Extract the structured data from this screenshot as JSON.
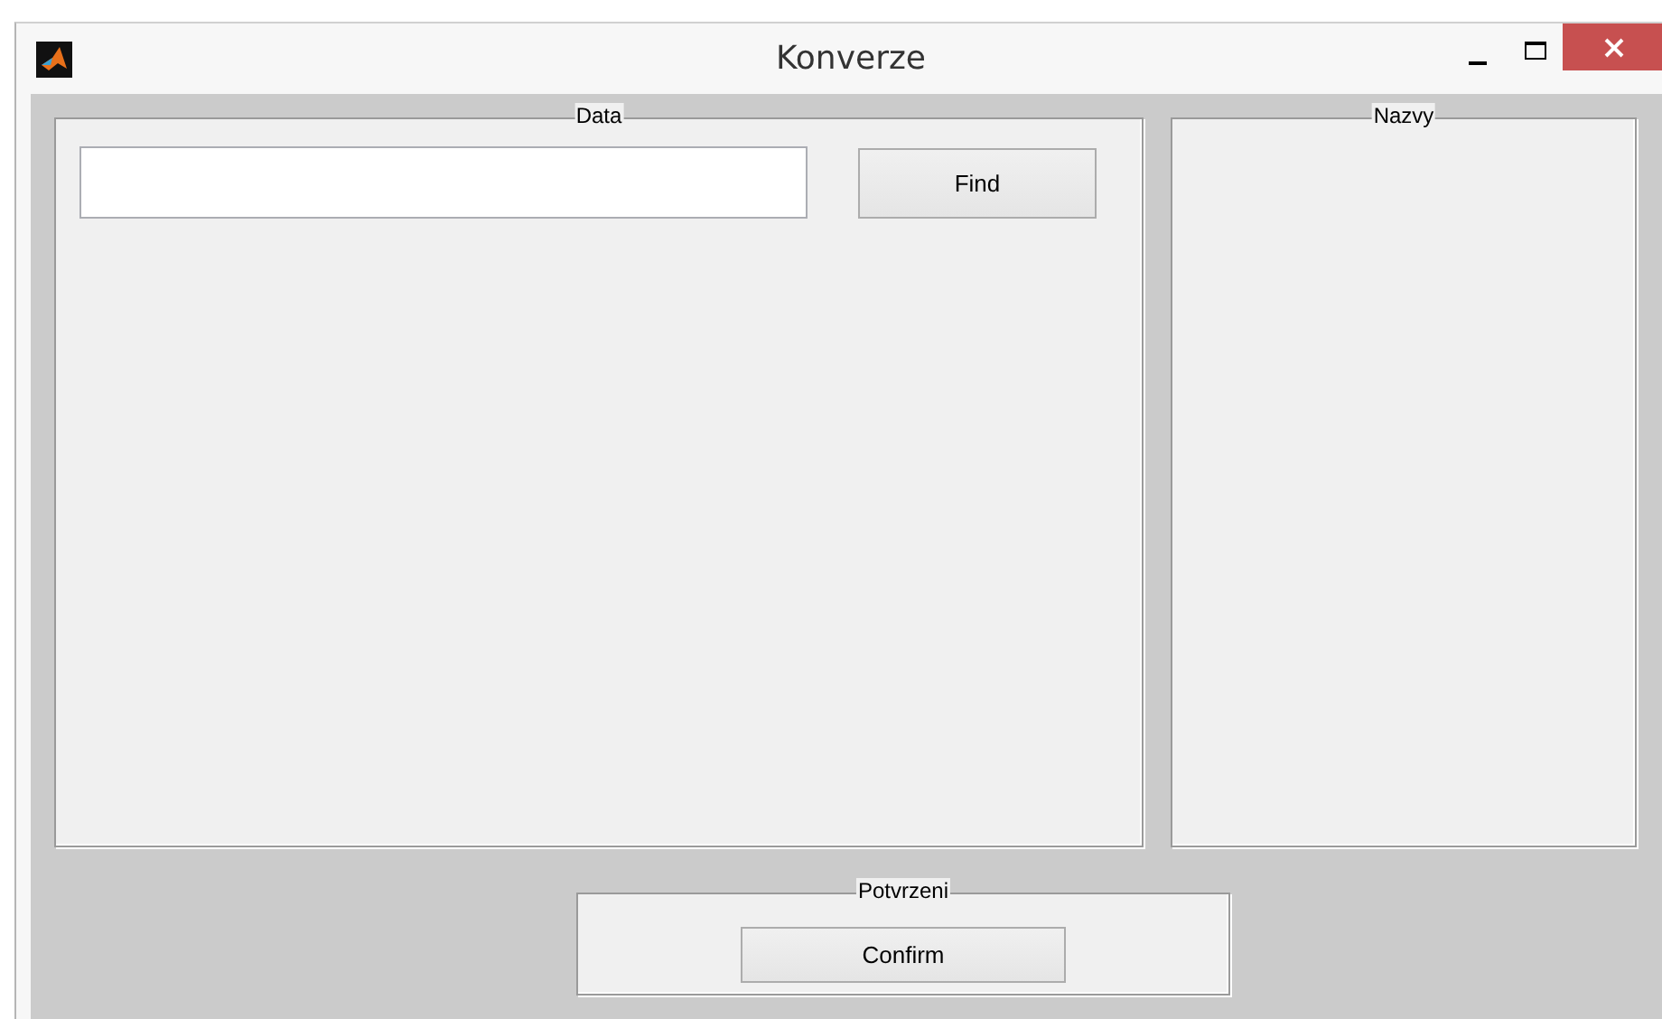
{
  "window": {
    "title": "Konverze"
  },
  "data_panel": {
    "title": "Data",
    "button": "Find"
  },
  "names_panel": {
    "title": "Nazvy"
  },
  "confirm_panel": {
    "title": "Potvrzeni",
    "button": "Confirm"
  }
}
